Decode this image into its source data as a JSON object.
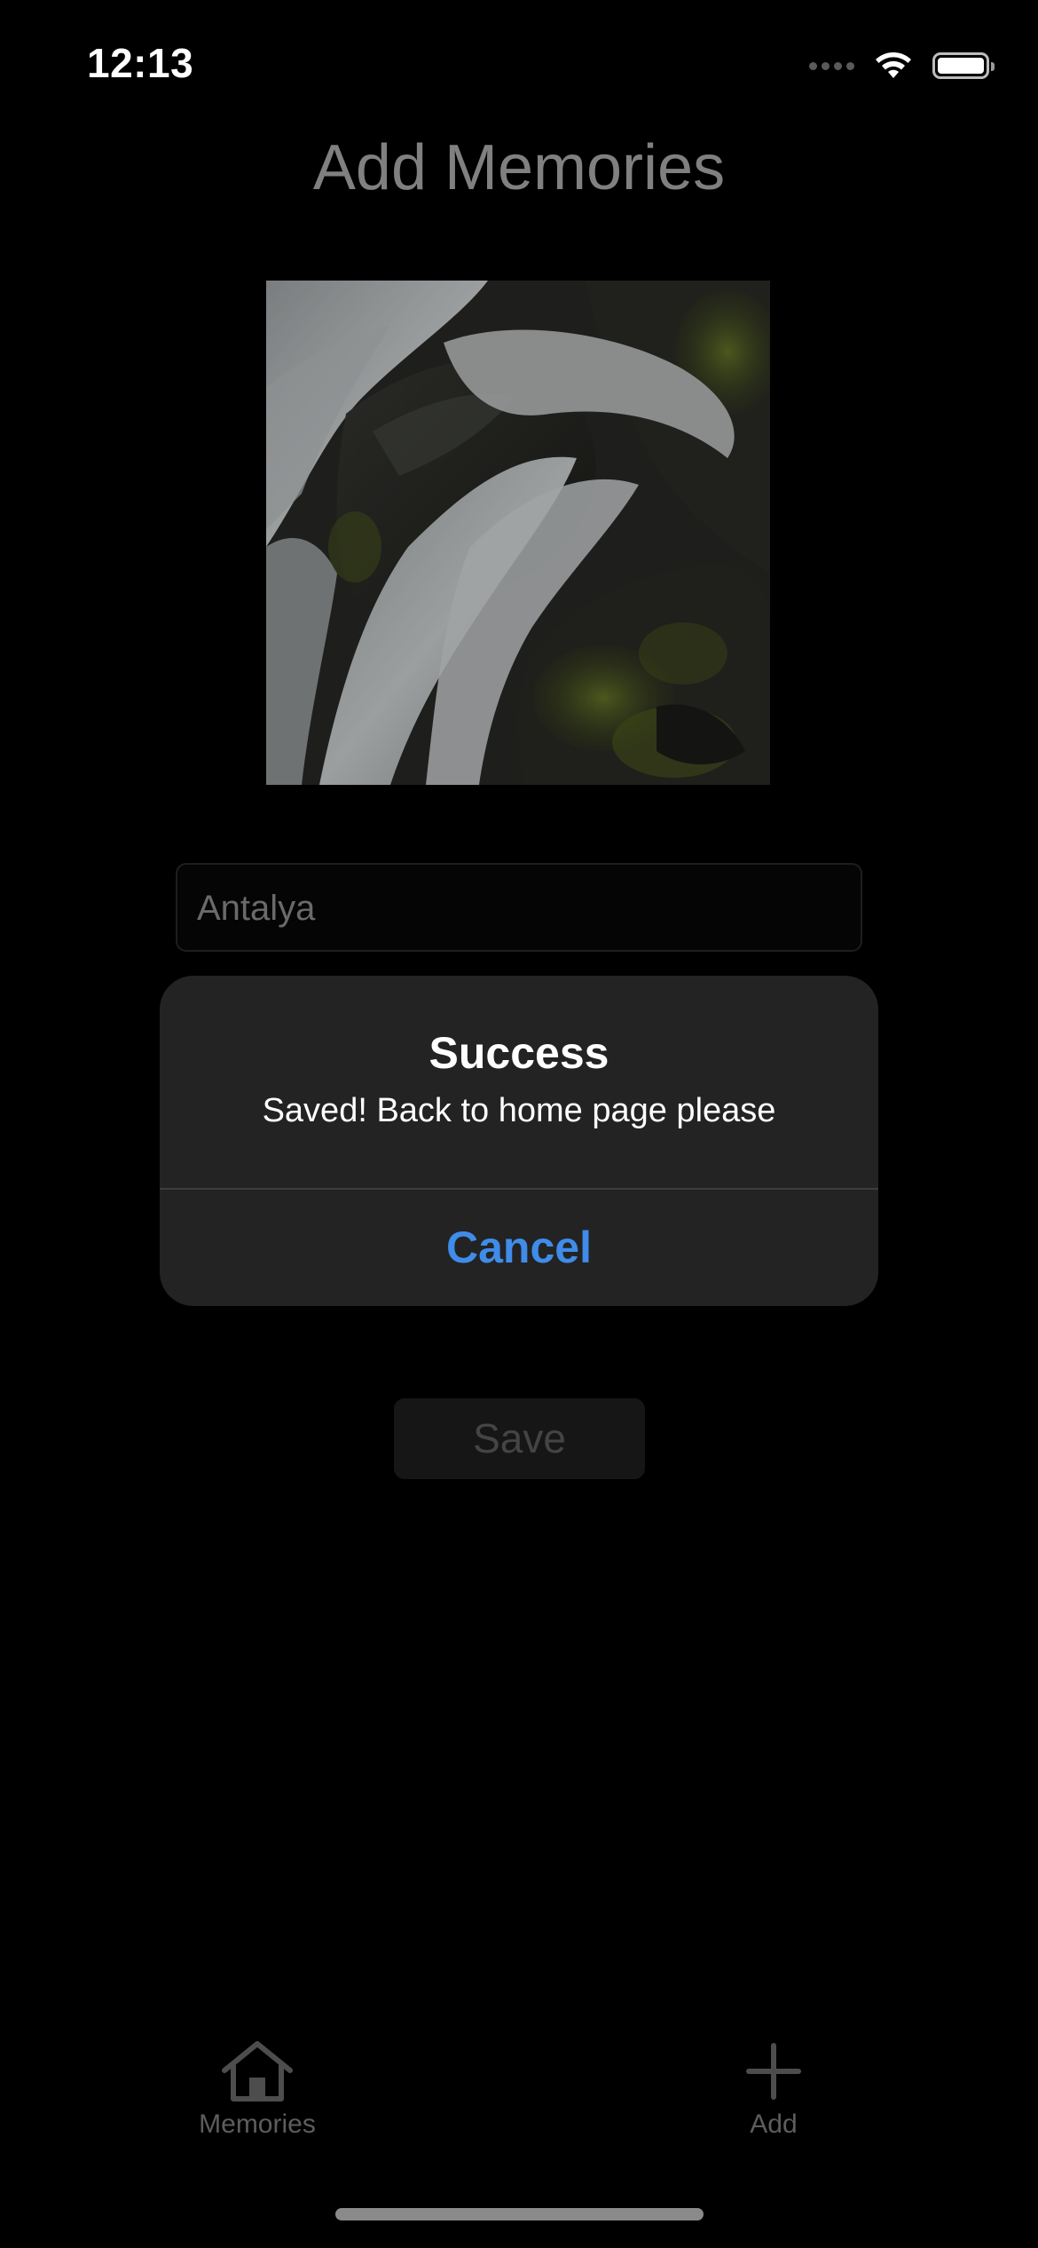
{
  "status_bar": {
    "time": "12:13",
    "battery_level": 1.0
  },
  "page": {
    "title": "Add Memories"
  },
  "photo": {
    "subject": "waterfall over mossy rocks"
  },
  "form": {
    "name_value": "Antalya",
    "save_label": "Save"
  },
  "alert": {
    "title": "Success",
    "message": "Saved! Back to home page please",
    "cancel_label": "Cancel"
  },
  "tab_bar": {
    "items": [
      {
        "label": "Memories",
        "icon": "house-icon"
      },
      {
        "label": "Add",
        "icon": "plus-icon"
      }
    ]
  },
  "colors": {
    "background": "#000000",
    "alert_background": "#232323",
    "accent": "#3f8ce9",
    "title_gray": "#808080"
  }
}
